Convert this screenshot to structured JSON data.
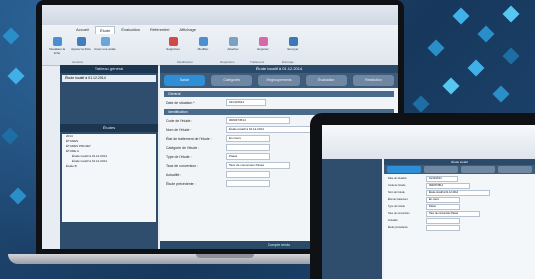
{
  "laptop": {
    "window_title": "Étude locatif",
    "tabs": [
      "Accueil",
      "Étude",
      "Évaluation",
      "Référentiel",
      "Affichage"
    ],
    "active_tab": "Étude",
    "ribbon_buttons": [
      "Visualiser la fiche",
      "Ajouter la fiche",
      "Créer une étude",
      "Supprimer",
      "Modifier",
      "Attacher",
      "Exporter",
      "Envoyer"
    ],
    "ribbon_groups": [
      "Général",
      "Modification",
      "Réparation",
      "Traitement",
      "Échange"
    ],
    "left_panel": {
      "title": "Tableau général",
      "study_item": "Étude locatif à 01.12.2014",
      "tree_title": "Études",
      "tree_items": [
        "2014",
        "ÉTUDES",
        "ÉTUDES PROJET",
        "ÉTUDE A",
        "Étude locatif à 01.12.2014",
        "Étude locatif à 01.12.2014",
        "Étude B"
      ]
    },
    "main": {
      "header": "Étude locatif à 01.12.2014",
      "steps": [
        "Saisie",
        "Catégories",
        "Regroupements",
        "Évaluation",
        "Restitution"
      ],
      "section_general": "Général",
      "section_identification": "Identification",
      "date_label": "Date de situation *",
      "date_value": "01/12/2014",
      "fields": [
        {
          "label": "Code de l'étude :",
          "value": "0000374514"
        },
        {
          "label": "Nom de l'étude :",
          "value": "Étude locatif à 01.12.2014"
        },
        {
          "label": "État de traitement de l'étude :",
          "value": "En cours"
        },
        {
          "label": "Catégorie de l'étude :",
          "value": ""
        },
        {
          "label": "Type de l'étude :",
          "value": "Passé"
        },
        {
          "label": "Taux de conversion :",
          "value": "Taux de conversion Passé"
        },
        {
          "label": "Actualité :",
          "value": ""
        },
        {
          "label": "Étude précédente :",
          "value": ""
        }
      ],
      "footer": "Compte rendu"
    }
  },
  "tablet": {
    "header": "Étude locatif",
    "date_label": "Date de situation",
    "date_value": "01/12/2014",
    "fields": [
      {
        "label": "Code de l'étude",
        "value": "0000374514"
      },
      {
        "label": "Nom de l'étude",
        "value": "Étude locatif à 01.12.2014"
      },
      {
        "label": "État de traitement",
        "value": "En cours"
      },
      {
        "label": "Type de l'étude",
        "value": "Passé"
      },
      {
        "label": "Taux de conversion",
        "value": "Taux de conversion Passé"
      },
      {
        "label": "Actualité",
        "value": ""
      },
      {
        "label": "Étude précédente",
        "value": ""
      }
    ]
  },
  "colors": {
    "accent": "#2e8fd6",
    "panel": "#2f4d6c",
    "background": "#1a3d62"
  }
}
